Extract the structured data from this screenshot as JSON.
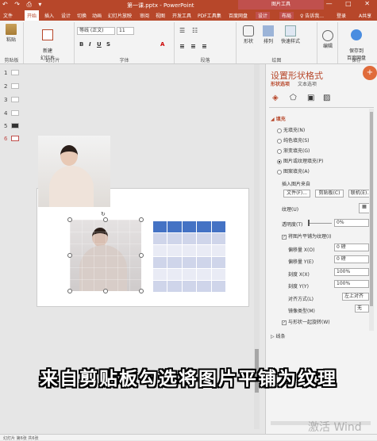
{
  "window": {
    "title": "第一课.pptx - PowerPoint",
    "context_tab_group": "图片工具",
    "quick_access": "↶ ↷ ⎙ ▾",
    "window_controls": "— □ ✕"
  },
  "tabs": [
    "文件",
    "开始",
    "插入",
    "设计",
    "切换",
    "动画",
    "幻灯片放映",
    "审阅",
    "视图",
    "开发工具",
    "PDF工具集",
    "百度网盘",
    "设计",
    "布局"
  ],
  "tell_me": "♀ 告诉我...",
  "login": "登录",
  "share": "A共享",
  "ribbon": {
    "paste": "粘贴",
    "new_slide": "新建\n幻灯片",
    "clipboard": "剪贴板",
    "slides": "幻灯片",
    "font_name": "等线 (正文)",
    "font_size": "11",
    "font": "字体",
    "paragraph": "段落",
    "shape": "形状",
    "arrange": "排列",
    "quick_styles": "快速样式",
    "drawing": "绘图",
    "edit": "编辑",
    "save_baidu": "保存到\n百度网盘",
    "save": "保存"
  },
  "slides_panel": {
    "numbers": [
      "1",
      "2",
      "3",
      "4",
      "5",
      "6"
    ]
  },
  "format_pane": {
    "title": "设置形状格式",
    "tab1": "形状选项",
    "tab2": "文本选项",
    "section_fill": "填充",
    "options": [
      "无填充(N)",
      "纯色填充(S)",
      "渐变填充(G)",
      "图片或纹理填充(P)",
      "图案填充(A)"
    ],
    "insert_from": "插入图片来自",
    "btn_file": "文件(F)...",
    "btn_clipboard": "剪贴板(C)",
    "btn_online": "联机(E)...",
    "texture": "纹理(U)",
    "transparency": "透明度(T)",
    "transparency_value": "0%",
    "tile": "将图片平铺为纹理(I)",
    "offset_x": "偏移量 X(O)",
    "offset_x_value": "0 磅",
    "offset_y": "偏移量 Y(E)",
    "offset_y_value": "0 磅",
    "scale_x": "刻度 X(X)",
    "scale_x_value": "100%",
    "scale_y": "刻度 Y(Y)",
    "scale_y_value": "100%",
    "align": "对齐方式(L)",
    "align_value": "左上对齐",
    "mirror": "镜像类型(M)",
    "mirror_value": "无",
    "rotate": "与形状一起旋转(W)",
    "section_line": "线条"
  },
  "caption": "来自剪贴板勾选将图片平铺为纹理",
  "watermark": "激活 Wind",
  "statusbar": "幻灯片 第6张 共6张"
}
